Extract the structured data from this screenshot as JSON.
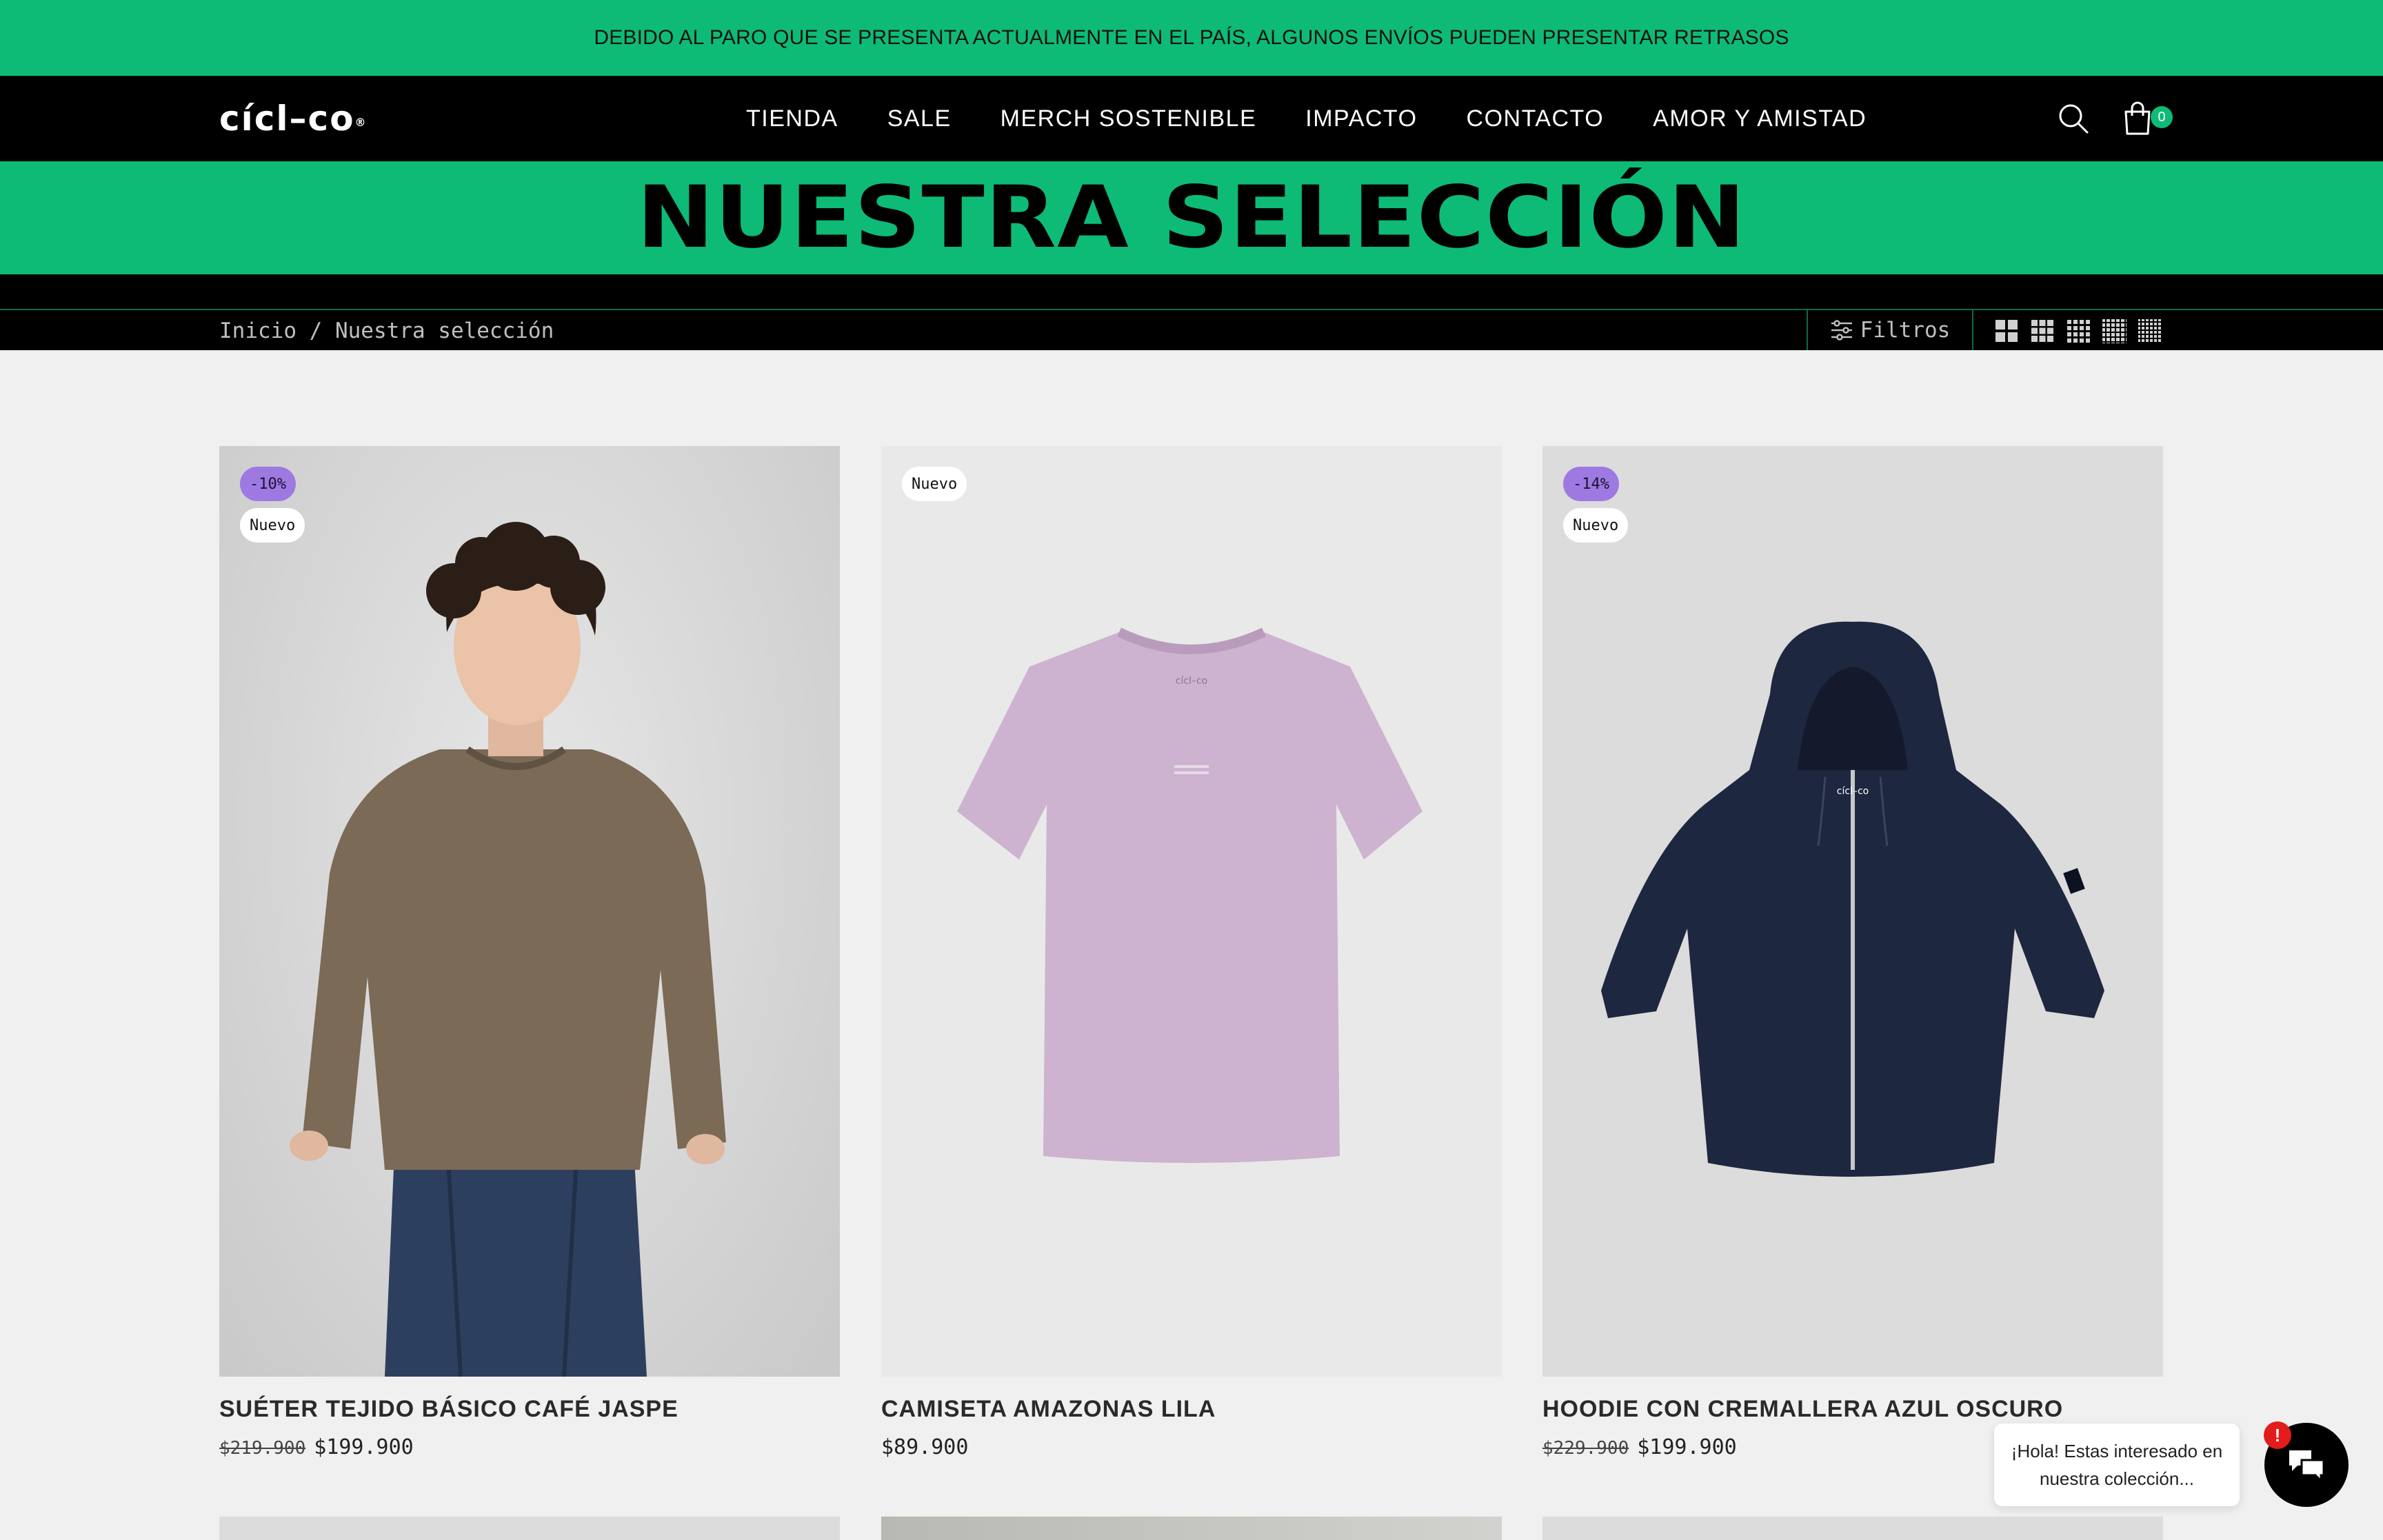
{
  "announcement": "DEBIDO AL PARO QUE SE PRESENTA ACTUALMENTE EN EL PAÍS, ALGUNOS ENVÍOS PUEDEN PRESENTAR RETRASOS",
  "header": {
    "logo": "cícl–co",
    "logo_mark": "®",
    "nav": [
      "TIENDA",
      "SALE",
      "MERCH SOSTENIBLE",
      "IMPACTO",
      "CONTACTO",
      "AMOR Y AMISTAD"
    ],
    "cart_count": "0",
    "icons": {
      "search": "search-icon",
      "cart": "shopping-bag-icon"
    }
  },
  "hero": {
    "title": "NUESTRA SELECCIÓN"
  },
  "toolbar": {
    "breadcrumb": "Inicio / Nuestra selección",
    "filters_label": "Filtros",
    "grid_options": [
      "grid-2-icon",
      "grid-3-icon",
      "grid-4-icon",
      "grid-5-icon",
      "grid-6-icon"
    ]
  },
  "colors": {
    "brand_green": "#0dbb77",
    "sale_badge": "#9e79e2",
    "header_bg": "#000000"
  },
  "products": [
    {
      "badges": [
        "-10%",
        "Nuevo"
      ],
      "title": "SUÉTER TEJIDO BÁSICO CAFÉ JASPE",
      "old_price": "$219.900",
      "price": "$199.900",
      "image": "man-in-brown-sweater-photo"
    },
    {
      "badges": [
        "Nuevo"
      ],
      "title": "CAMISETA AMAZONAS LILA",
      "old_price": "",
      "price": "$89.900",
      "image": "lilac-tshirt-photo",
      "print_text": "cícl–co"
    },
    {
      "badges": [
        "-14%",
        "Nuevo"
      ],
      "title": "HOODIE CON CREMALLERA AZUL OSCURO",
      "old_price": "$229.900",
      "price": "$199.900",
      "image": "navy-zip-hoodie-photo",
      "print_text": "cícl–co"
    }
  ],
  "chat": {
    "message": "¡Hola! Estas interesado en nuestra colección...",
    "alert": "!"
  }
}
